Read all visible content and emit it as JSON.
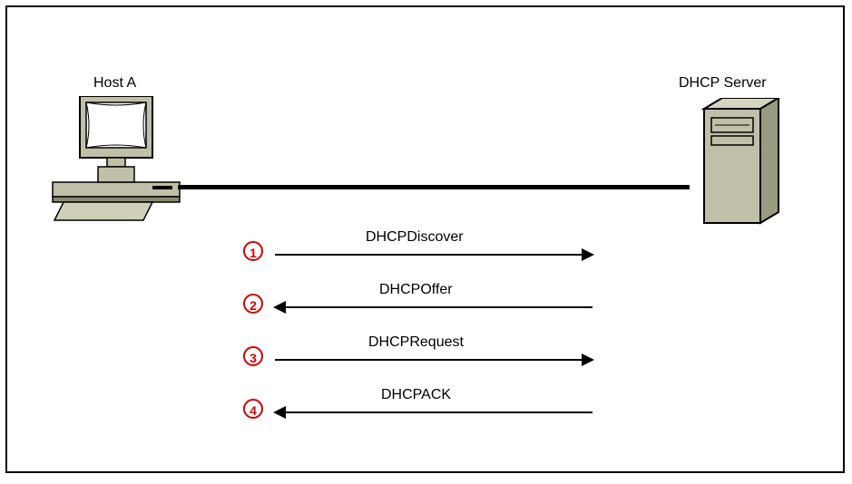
{
  "host": {
    "label": "Host A"
  },
  "server": {
    "label": "DHCP Server"
  },
  "steps": [
    {
      "num": "1",
      "label": "DHCPDiscover",
      "dir": "right"
    },
    {
      "num": "2",
      "label": "DHCPOffer",
      "dir": "left"
    },
    {
      "num": "3",
      "label": "DHCPRequest",
      "dir": "right"
    },
    {
      "num": "4",
      "label": "DHCPACK",
      "dir": "left"
    }
  ]
}
